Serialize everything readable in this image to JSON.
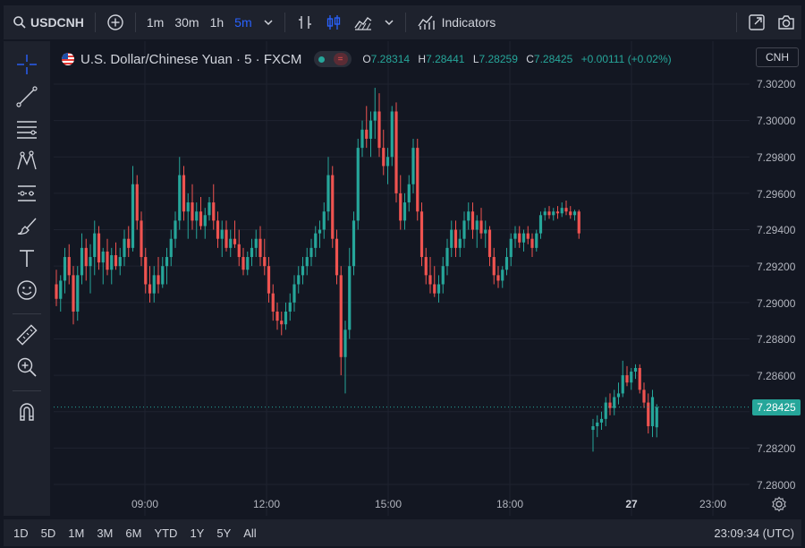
{
  "toolbar": {
    "symbol": "USDCNH",
    "intervals": [
      "1m",
      "30m",
      "1h",
      "5m"
    ],
    "active_interval": "5m",
    "indicators_label": "Indicators",
    "icons": [
      "search-icon",
      "add-circle-icon",
      "chevron-down-icon",
      "bar-style-icon",
      "candle-style-icon",
      "area-style-icon",
      "indicators-icon",
      "fullscreen-icon",
      "camera-icon"
    ]
  },
  "legend": {
    "title": "U.S. Dollar/Chinese Yuan · 5 · FXCM",
    "open_label": "O",
    "open": "7.28314",
    "high_label": "H",
    "high": "7.28441",
    "low_label": "L",
    "low": "7.28259",
    "close_label": "C",
    "close": "7.28425",
    "change": "+0.00111 (+0.02%)"
  },
  "currency": "CNH",
  "price_axis": {
    "ticks": [
      "7.30200",
      "7.30000",
      "7.29800",
      "7.29600",
      "7.29400",
      "7.29200",
      "7.29000",
      "7.28800",
      "7.28600",
      "7.28400",
      "7.28200",
      "7.28000"
    ],
    "last_price": "7.28425"
  },
  "time_axis": {
    "ticks": [
      "09:00",
      "12:00",
      "15:00",
      "18:00",
      "27",
      "23:00"
    ]
  },
  "ranges": [
    "1D",
    "5D",
    "1M",
    "3M",
    "6M",
    "YTD",
    "1Y",
    "5Y",
    "All"
  ],
  "clock": "23:09:34 (UTC)",
  "colors": {
    "up": "#26a69a",
    "down": "#ef5350",
    "background": "#131722",
    "panel": "#1e222d"
  },
  "chart_data": {
    "type": "candlestick",
    "y_range": [
      7.2798,
      7.3022
    ],
    "candles": [
      [
        7.291,
        7.2918,
        7.2898,
        7.2902
      ],
      [
        7.2902,
        7.2915,
        7.2895,
        7.2912
      ],
      [
        7.2912,
        7.293,
        7.2905,
        7.2925
      ],
      [
        7.2925,
        7.2932,
        7.291,
        7.2915
      ],
      [
        7.2915,
        7.292,
        7.2888,
        7.2895
      ],
      [
        7.2895,
        7.292,
        7.289,
        7.2915
      ],
      [
        7.2915,
        7.2938,
        7.291,
        7.293
      ],
      [
        7.293,
        7.2935,
        7.2912,
        7.292
      ],
      [
        7.292,
        7.2932,
        7.2905,
        7.2925
      ],
      [
        7.2925,
        7.2945,
        7.2915,
        7.2938
      ],
      [
        7.2938,
        7.2942,
        7.2918,
        7.2922
      ],
      [
        7.2922,
        7.293,
        7.291,
        7.2928
      ],
      [
        7.2928,
        7.2935,
        7.2915,
        7.2918
      ],
      [
        7.2918,
        7.293,
        7.291,
        7.2926
      ],
      [
        7.2926,
        7.2933,
        7.2918,
        7.292
      ],
      [
        7.292,
        7.293,
        7.2915,
        7.2925
      ],
      [
        7.2925,
        7.294,
        7.292,
        7.2935
      ],
      [
        7.2935,
        7.2942,
        7.2925,
        7.293
      ],
      [
        7.293,
        7.2975,
        7.2928,
        7.2965
      ],
      [
        7.2965,
        7.297,
        7.294,
        7.2945
      ],
      [
        7.2945,
        7.295,
        7.292,
        7.2925
      ],
      [
        7.2925,
        7.293,
        7.2905,
        7.291
      ],
      [
        7.291,
        7.292,
        7.29,
        7.2905
      ],
      [
        7.2905,
        7.292,
        7.29,
        7.2915
      ],
      [
        7.2915,
        7.2925,
        7.2905,
        7.291
      ],
      [
        7.291,
        7.2925,
        7.2908,
        7.292
      ],
      [
        7.292,
        7.293,
        7.291,
        7.2925
      ],
      [
        7.2925,
        7.294,
        7.292,
        7.2935
      ],
      [
        7.2935,
        7.295,
        7.293,
        7.2945
      ],
      [
        7.2945,
        7.298,
        7.294,
        7.297
      ],
      [
        7.297,
        7.2975,
        7.2945,
        7.295
      ],
      [
        7.295,
        7.296,
        7.2935,
        7.2955
      ],
      [
        7.2955,
        7.2965,
        7.294,
        7.2945
      ],
      [
        7.2945,
        7.2955,
        7.2935,
        7.295
      ],
      [
        7.295,
        7.2958,
        7.294,
        7.2942
      ],
      [
        7.2942,
        7.2952,
        7.2935,
        7.2948
      ],
      [
        7.2948,
        7.2958,
        7.2945,
        7.2955
      ],
      [
        7.2955,
        7.2965,
        7.294,
        7.2945
      ],
      [
        7.2945,
        7.295,
        7.293,
        7.2935
      ],
      [
        7.2935,
        7.2945,
        7.2925,
        7.294
      ],
      [
        7.294,
        7.2945,
        7.2928,
        7.293
      ],
      [
        7.293,
        7.294,
        7.2925,
        7.2935
      ],
      [
        7.2935,
        7.2945,
        7.293,
        7.2932
      ],
      [
        7.2932,
        7.294,
        7.292,
        7.2925
      ],
      [
        7.2925,
        7.293,
        7.2915,
        7.2918
      ],
      [
        7.2918,
        7.2928,
        7.2915,
        7.2925
      ],
      [
        7.2925,
        7.2935,
        7.292,
        7.293
      ],
      [
        7.293,
        7.294,
        7.2925,
        7.2935
      ],
      [
        7.2935,
        7.2942,
        7.292,
        7.2925
      ],
      [
        7.2925,
        7.2935,
        7.2915,
        7.292
      ],
      [
        7.292,
        7.2925,
        7.29,
        7.2905
      ],
      [
        7.2905,
        7.291,
        7.289,
        7.2895
      ],
      [
        7.2895,
        7.29,
        7.2885,
        7.289
      ],
      [
        7.289,
        7.2895,
        7.2882,
        7.2888
      ],
      [
        7.2888,
        7.29,
        7.2885,
        7.2895
      ],
      [
        7.2895,
        7.2905,
        7.289,
        7.29
      ],
      [
        7.29,
        7.2915,
        7.2895,
        7.291
      ],
      [
        7.291,
        7.292,
        7.2905,
        7.2915
      ],
      [
        7.2915,
        7.2925,
        7.291,
        7.292
      ],
      [
        7.292,
        7.293,
        7.2915,
        7.2925
      ],
      [
        7.2925,
        7.2935,
        7.292,
        7.293
      ],
      [
        7.293,
        7.2942,
        7.2925,
        7.2938
      ],
      [
        7.2938,
        7.2945,
        7.293,
        7.294
      ],
      [
        7.294,
        7.2955,
        7.2935,
        7.295
      ],
      [
        7.295,
        7.298,
        7.2945,
        7.297
      ],
      [
        7.297,
        7.2975,
        7.293,
        7.2935
      ],
      [
        7.2935,
        7.294,
        7.291,
        7.2915
      ],
      [
        7.2915,
        7.292,
        7.286,
        7.287
      ],
      [
        7.287,
        7.289,
        7.285,
        7.2885
      ],
      [
        7.2885,
        7.293,
        7.288,
        7.292
      ],
      [
        7.292,
        7.295,
        7.2915,
        7.2945
      ],
      [
        7.2945,
        7.299,
        7.294,
        7.2985
      ],
      [
        7.2985,
        7.3,
        7.298,
        7.2995
      ],
      [
        7.2995,
        7.3008,
        7.2985,
        7.299
      ],
      [
        7.299,
        7.3005,
        7.298,
        7.3
      ],
      [
        7.3,
        7.3018,
        7.299,
        7.3005
      ],
      [
        7.3005,
        7.3015,
        7.298,
        7.2985
      ],
      [
        7.2985,
        7.2995,
        7.297,
        7.2975
      ],
      [
        7.2975,
        7.2985,
        7.2965,
        7.298
      ],
      [
        7.298,
        7.3008,
        7.2975,
        7.3005
      ],
      [
        7.3005,
        7.301,
        7.2955,
        7.296
      ],
      [
        7.296,
        7.297,
        7.294,
        7.2945
      ],
      [
        7.2945,
        7.296,
        7.294,
        7.2955
      ],
      [
        7.2955,
        7.297,
        7.295,
        7.2965
      ],
      [
        7.2965,
        7.299,
        7.296,
        7.2985
      ],
      [
        7.2985,
        7.299,
        7.2945,
        7.295
      ],
      [
        7.295,
        7.2955,
        7.292,
        7.2925
      ],
      [
        7.2925,
        7.293,
        7.291,
        7.2915
      ],
      [
        7.2915,
        7.2925,
        7.2905,
        7.291
      ],
      [
        7.291,
        7.292,
        7.2903,
        7.2905
      ],
      [
        7.2905,
        7.2915,
        7.29,
        7.291
      ],
      [
        7.291,
        7.2925,
        7.2905,
        7.292
      ],
      [
        7.292,
        7.2935,
        7.2915,
        7.293
      ],
      [
        7.293,
        7.2945,
        7.2925,
        7.294
      ],
      [
        7.294,
        7.2945,
        7.2925,
        7.293
      ],
      [
        7.293,
        7.294,
        7.2925,
        7.2935
      ],
      [
        7.2935,
        7.295,
        7.293,
        7.2945
      ],
      [
        7.2945,
        7.2955,
        7.294,
        7.295
      ],
      [
        7.295,
        7.2955,
        7.2935,
        7.294
      ],
      [
        7.294,
        7.2948,
        7.293,
        7.2945
      ],
      [
        7.2945,
        7.2952,
        7.2935,
        7.2938
      ],
      [
        7.2938,
        7.2945,
        7.293,
        7.294
      ],
      [
        7.294,
        7.2942,
        7.292,
        7.2925
      ],
      [
        7.2925,
        7.293,
        7.291,
        7.2915
      ],
      [
        7.2915,
        7.292,
        7.2908,
        7.2912
      ],
      [
        7.2912,
        7.292,
        7.2908,
        7.2918
      ],
      [
        7.2918,
        7.293,
        7.2915,
        7.2925
      ],
      [
        7.2925,
        7.2938,
        7.292,
        7.2935
      ],
      [
        7.2935,
        7.2942,
        7.293,
        7.2938
      ],
      [
        7.2938,
        7.2942,
        7.293,
        7.2933
      ],
      [
        7.2933,
        7.294,
        7.2928,
        7.2938
      ],
      [
        7.2938,
        7.2942,
        7.2932,
        7.2935
      ],
      [
        7.2935,
        7.2938,
        7.2925,
        7.293
      ],
      [
        7.293,
        7.294,
        7.2928,
        7.2938
      ],
      [
        7.2938,
        7.295,
        7.2935,
        7.2948
      ],
      [
        7.2948,
        7.2952,
        7.2945,
        7.295
      ],
      [
        7.295,
        7.2953,
        7.2946,
        7.2948
      ],
      [
        7.2948,
        7.2952,
        7.2945,
        7.295
      ],
      [
        7.295,
        7.2953,
        7.2946,
        7.2949
      ],
      [
        7.2949,
        7.2955,
        7.2947,
        7.2952
      ],
      [
        7.2952,
        7.2956,
        7.2948,
        7.295
      ],
      [
        7.295,
        7.2953,
        7.2946,
        7.2948
      ],
      [
        7.2948,
        7.2951,
        7.2945,
        7.295
      ],
      [
        7.295,
        7.2951,
        7.2935,
        7.2938
      ],
      [
        7.283,
        7.2836,
        7.2818,
        7.2832
      ],
      [
        7.2832,
        7.2838,
        7.2826,
        7.2834
      ],
      [
        7.2834,
        7.284,
        7.283,
        7.2836
      ],
      [
        7.2836,
        7.2848,
        7.2832,
        7.2845
      ],
      [
        7.2845,
        7.285,
        7.2838,
        7.2842
      ],
      [
        7.2842,
        7.2852,
        7.2838,
        7.2848
      ],
      [
        7.2848,
        7.2856,
        7.2844,
        7.285
      ],
      [
        7.285,
        7.2868,
        7.2848,
        7.286
      ],
      [
        7.286,
        7.2865,
        7.2854,
        7.2856
      ],
      [
        7.2856,
        7.2864,
        7.2852,
        7.2862
      ],
      [
        7.2862,
        7.2866,
        7.2858,
        7.2864
      ],
      [
        7.2864,
        7.2866,
        7.285,
        7.2852
      ],
      [
        7.2852,
        7.2856,
        7.2842,
        7.2845
      ],
      [
        7.2845,
        7.285,
        7.2828,
        7.2832
      ],
      [
        7.2832,
        7.2852,
        7.2826,
        7.2848
      ],
      [
        7.28314,
        7.28441,
        7.28259,
        7.28425
      ]
    ]
  }
}
